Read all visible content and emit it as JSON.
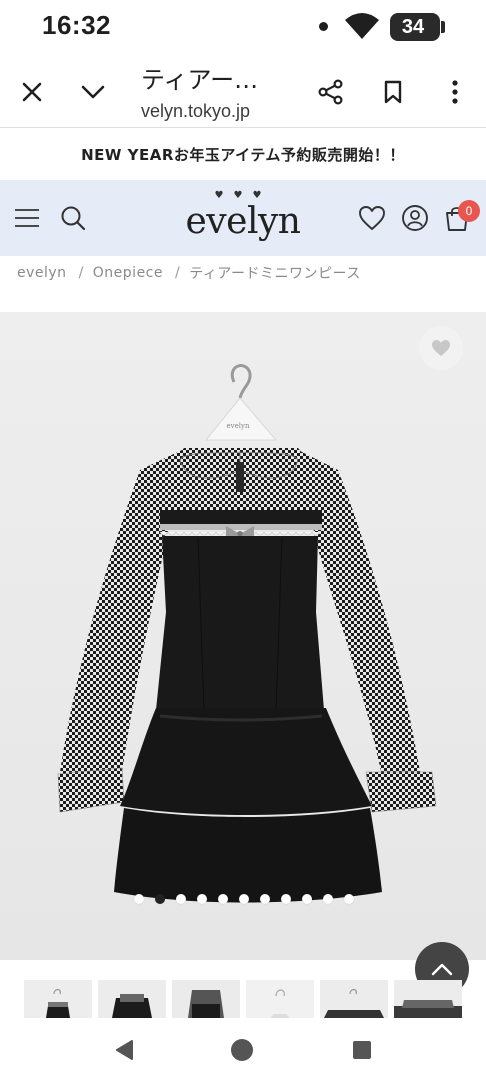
{
  "status_bar": {
    "time": "16:32",
    "battery": "34",
    "icons": [
      "notification-dot-icon",
      "wifi-icon",
      "battery-icon"
    ]
  },
  "browser": {
    "title": "ティアー…",
    "url": "velyn.tokyo.jp",
    "icons": [
      "close-icon",
      "chevron-down-icon",
      "share-icon",
      "bookmark-icon",
      "more-icon"
    ]
  },
  "announcement": "NEW YEARお年玉アイテム予約販売開始！！",
  "header": {
    "logo_hearts": "♥♥♥",
    "logo_text": "evelyn",
    "cart_count": "0",
    "icons": [
      "menu-icon",
      "search-icon",
      "heart-icon",
      "account-icon",
      "cart-icon"
    ],
    "background": "#e5ebf7",
    "badge_color": "#e8574f"
  },
  "breadcrumb": {
    "items": [
      "evelyn",
      "Onepiece",
      "ティアードミニワンピース"
    ],
    "separator": "/"
  },
  "gallery": {
    "image_count": 11,
    "active_index": 1,
    "hanger_tag": "evelyn",
    "thumbnail_count": 6,
    "icons": [
      "favorite-heart-icon",
      "chevron-up-icon"
    ]
  },
  "nav": {
    "icons": [
      "back-icon",
      "home-icon",
      "recents-icon"
    ]
  }
}
